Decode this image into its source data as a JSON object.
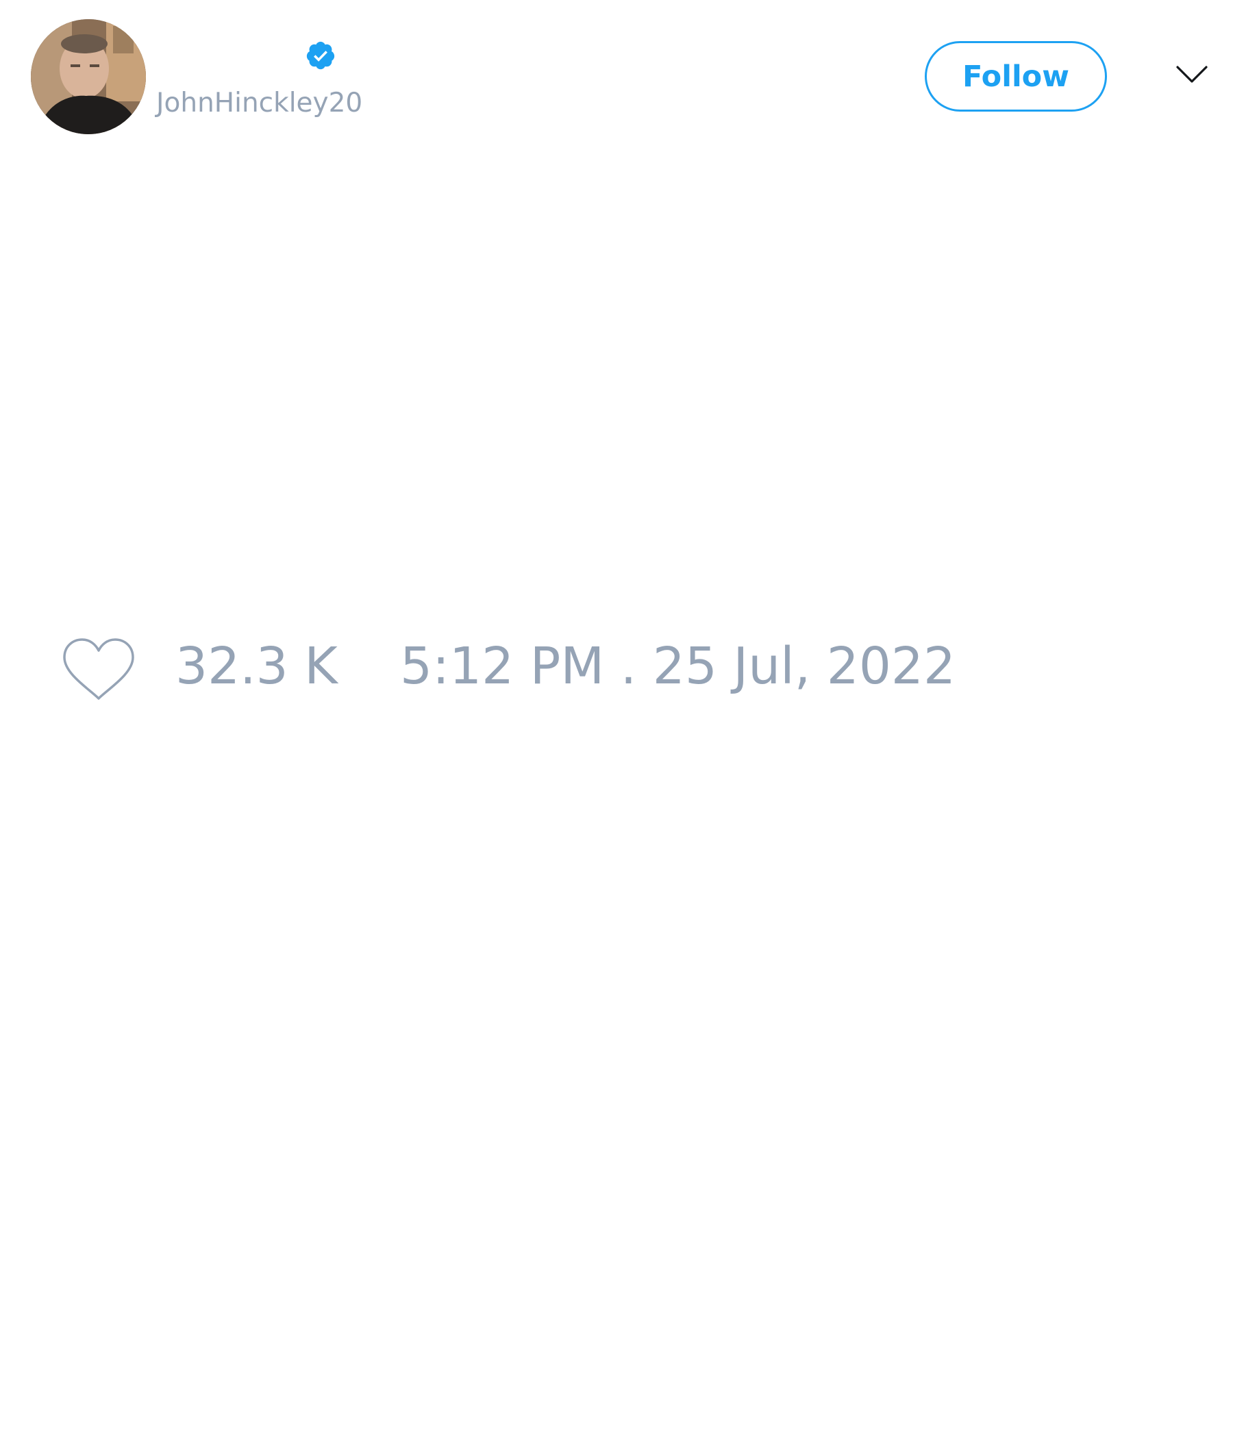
{
  "tweet": {
    "author": {
      "display_name": "",
      "handle": "JohnHinckley20",
      "verified": true,
      "avatar_icon": "profile-photo"
    },
    "follow_button_label": "Follow",
    "menu_icon": "chevron-down-icon",
    "like_icon": "heart-icon",
    "like_count": "32.3 K",
    "timestamp": "5:12 PM . 25 Jul, 2022"
  },
  "colors": {
    "accent": "#1da1f2",
    "muted_text": "#95a3b5",
    "background": "#ffffff"
  }
}
